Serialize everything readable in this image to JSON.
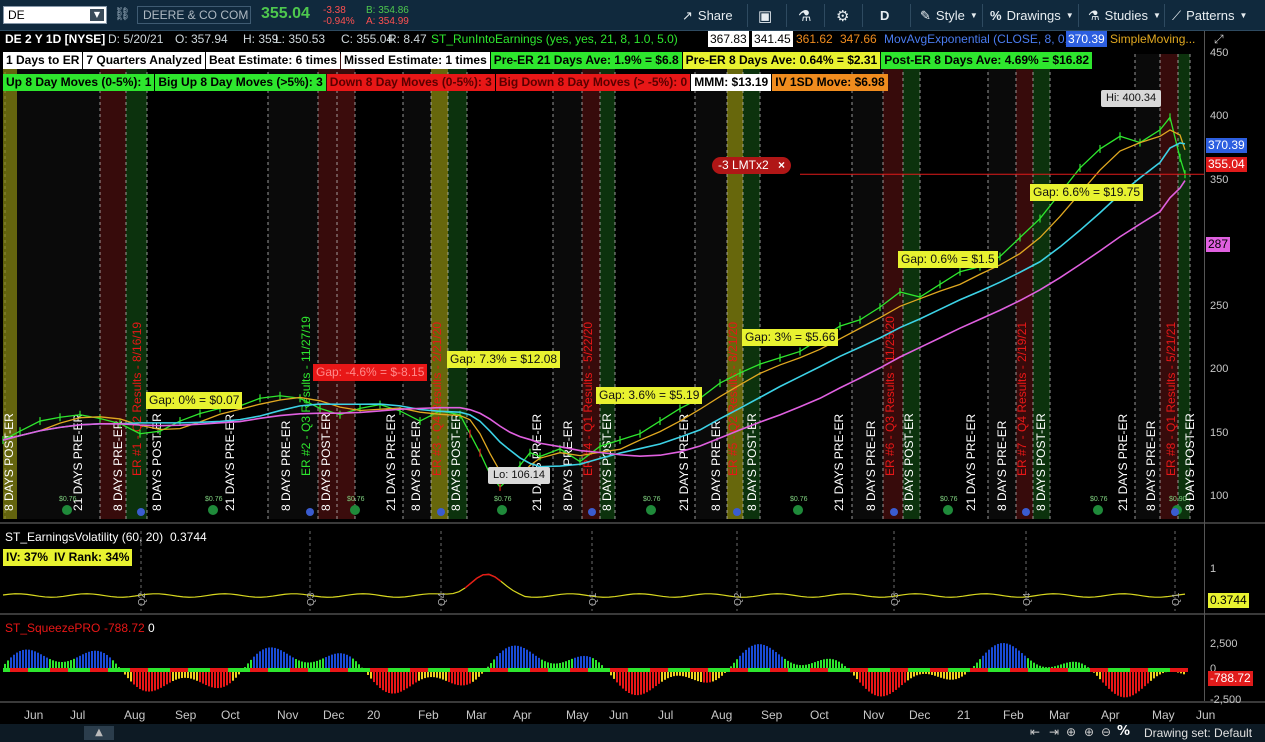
{
  "toolbar": {
    "symbol": "DE",
    "company": "DEERE & CO COM",
    "last": "355.04",
    "change": "-3.38",
    "change_pct": "-0.94%",
    "bid": "B: 354.86",
    "ask": "A: 354.99",
    "share": "Share",
    "timeframe": "D",
    "style": "Style",
    "drawings": "Drawings",
    "studies": "Studies",
    "patterns": "Patterns"
  },
  "chart_header": {
    "title": "DE 2 Y 1D [NYSE]",
    "date": "D: 5/20/21",
    "open": "O: 357.94",
    "high": "H: 359",
    "low": "L: 350.53",
    "close": "C: 355.04",
    "range": "R: 8.47",
    "study1": "ST_RunIntoEarnings (yes, yes, 21, 8, 1.0, 5.0)",
    "study1_v1": "367.83",
    "study1_v2": "341.45",
    "study1_v3": "361.62",
    "study1_v4": "347.66",
    "study2": "MovAvgExponential (CLOSE, 8, 0, no)",
    "study2_v": "370.39",
    "study3": "SimpleMoving..."
  },
  "stats_row1": [
    {
      "text": "1 Days to ER",
      "bg": "#ffffff",
      "fg": "#000000"
    },
    {
      "text": "7 Quarters Analyzed",
      "bg": "#ffffff",
      "fg": "#000000"
    },
    {
      "text": "Beat Estimate: 6 times",
      "bg": "#ffffff",
      "fg": "#000000"
    },
    {
      "text": "Missed Estimate: 1 times",
      "bg": "#ffffff",
      "fg": "#000000"
    },
    {
      "text": "Pre-ER 21 Days Ave: 1.9% = $6.8",
      "bg": "#2ee62e",
      "fg": "#000000"
    },
    {
      "text": "Pre-ER 8 Days Ave: 0.64% = $2.31",
      "bg": "#e8f230",
      "fg": "#000000"
    },
    {
      "text": "Post-ER 8 Days Ave: 4.69% = $16.82",
      "bg": "#2ee62e",
      "fg": "#000000"
    }
  ],
  "stats_row2": [
    {
      "text": "Up 8 Day Moves (0-5%): 1",
      "bg": "#2ee62e",
      "fg": "#000000"
    },
    {
      "text": "Big Up 8 Day Moves (>5%): 3",
      "bg": "#2ee62e",
      "fg": "#000000"
    },
    {
      "text": "Down 8 Day Moves (0-5%): 3",
      "bg": "#e81717",
      "fg": "#5a0000"
    },
    {
      "text": "Big Down 8 Day Moves (> -5%): 0",
      "bg": "#e81717",
      "fg": "#5a0000"
    },
    {
      "text": "MMM: $13.19",
      "bg": "#ffffff",
      "fg": "#000000"
    },
    {
      "text": "IV 1SD Move: $6.98",
      "bg": "#f08c1e",
      "fg": "#000000"
    }
  ],
  "gap_labels": [
    {
      "text": "Gap: 0% = $0.07",
      "style": "yellow"
    },
    {
      "text": "Gap: -4.6% = $-8.15",
      "style": "red"
    },
    {
      "text": "Gap: 7.3% = $12.08",
      "style": "yellow"
    },
    {
      "text": "Gap: 3.6% = $5.19",
      "style": "yellow"
    },
    {
      "text": "Gap: 3% = $5.66",
      "style": "yellow"
    },
    {
      "text": "Gap: 0.6% = $1.5",
      "style": "yellow"
    },
    {
      "text": "Gap: 6.6% = $19.75",
      "style": "yellow"
    }
  ],
  "hi_label": "Hi: 400.34",
  "lo_label": "Lo: 106.14",
  "order_label": "-3 LMTx2",
  "order_close": "×",
  "price_axis": [
    "450",
    "400",
    "350",
    "300",
    "250",
    "200",
    "150",
    "100"
  ],
  "price_tags": [
    {
      "text": "370.39",
      "bg": "#2d5fe0",
      "fg": "#ffffff"
    },
    {
      "text": "355.04",
      "bg": "#e01b1b",
      "fg": "#ffffff"
    },
    {
      "text": "287",
      "bg": "#e060e0",
      "fg": "#000000"
    }
  ],
  "vertical_texts": [
    "8 DAYS POST-ER",
    "21 DAYS PRE-ER",
    "8 DAYS PRE-ER",
    "ER #1 - Q2 Results - 8/16/19",
    "8 DAYS POST-ER",
    "21 DAYS PRE-ER",
    "8 DAYS PRE-ER",
    "ER #2 - Q3 Results - 11/27/19",
    "8 DAYS POST-ER",
    "21 DAYS PRE-ER",
    "8 DAYS PRE-ER",
    "ER #3 - Q4 Results - 2/21/20",
    "8 DAYS POST-ER",
    "21 DAYS PRE-ER",
    "8 DAYS PRE-ER",
    "ER #4 - Q1 Results - 5/22/20",
    "8 DAYS POST-ER",
    "21 DAYS PRE-ER",
    "8 DAYS PRE-ER",
    "ER #5 - Q2 Results - 8/21/20",
    "8 DAYS POST-ER",
    "21 DAYS PRE-ER",
    "8 DAYS PRE-ER",
    "ER #6 - Q3 Results - 11/25/20",
    "8 DAYS POST-ER",
    "21 DAYS PRE-ER",
    "8 DAYS PRE-ER",
    "ER #7 - Q4 Results - 2/19/21",
    "8 DAYS POST-ER",
    "21 DAYS PRE-ER",
    "8 DAYS PRE-ER",
    "ER #8 - Q1 Results - 5/21/21",
    "8 DAYS POST-ER"
  ],
  "dividend_labels": [
    "$0.76",
    "$0.76",
    "$0.76",
    "$0.76",
    "$0.76",
    "$0.76",
    "$0.76",
    "$0.76",
    "$0.90"
  ],
  "vol_panel": {
    "title": "ST_EarningsVolatility (60, 20)",
    "value": "0.3744",
    "iv": "IV: 37%",
    "iv_rank": "IV Rank: 34%",
    "axis": "1",
    "tag": "0.3744",
    "quarters": [
      "Q2",
      "Q3",
      "Q4",
      "Q1",
      "Q2",
      "Q3",
      "Q4",
      "Q1"
    ]
  },
  "squeeze_panel": {
    "title": "ST_SqueezePRO",
    "value": "-788.72",
    "value2": "0",
    "axis": [
      "2,500",
      "0",
      "-2,500"
    ],
    "tag": "-788.72"
  },
  "months": [
    "Jun",
    "Jul",
    "Aug",
    "Sep",
    "Oct",
    "Nov",
    "Dec",
    "20",
    "Feb",
    "Mar",
    "Apr",
    "May",
    "Jun",
    "Jul",
    "Aug",
    "Sep",
    "Oct",
    "Nov",
    "Dec",
    "21",
    "Feb",
    "Mar",
    "Apr",
    "May",
    "Jun"
  ],
  "bottom": {
    "drawing_set": "Drawing set: Default"
  },
  "colors": {
    "up": "#2ee62e",
    "down": "#e81717",
    "ema8": "#e0a820",
    "sma_cyan": "#3cd2e6",
    "sma_pink": "#e060e0",
    "band": "#f0e060"
  }
}
